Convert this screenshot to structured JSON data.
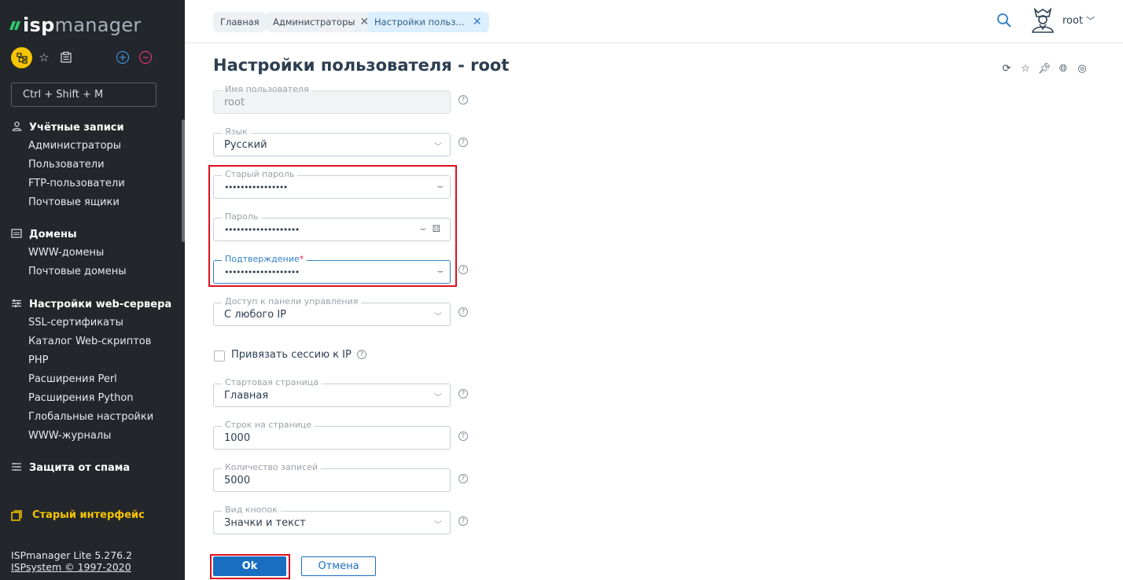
{
  "logo": {
    "prefix": "isp",
    "suffix": "manager"
  },
  "hotkey": "Ctrl + Shift + M",
  "nav": [
    {
      "title": "Учётные записи",
      "icon": "user-icon",
      "items": [
        "Администраторы",
        "Пользователи",
        "FTP-пользователи",
        "Почтовые ящики"
      ]
    },
    {
      "title": "Домены",
      "icon": "domain-icon",
      "items": [
        "WWW-домены",
        "Почтовые домены"
      ]
    },
    {
      "title": "Настройки web-сервера",
      "icon": "sliders-icon",
      "items": [
        "SSL-сертификаты",
        "Каталог Web-скриптов",
        "PHP",
        "Расширения Perl",
        "Расширения Python",
        "Глобальные настройки",
        "WWW-журналы"
      ]
    },
    {
      "title": "Защита от спама",
      "icon": "spam-icon",
      "items": []
    }
  ],
  "old_interface": "Старый интерфейс",
  "version": {
    "line1": "ISPmanager Lite 5.276.2",
    "line2": "ISPsystem © 1997-2020"
  },
  "breadcrumbs": [
    {
      "label": "Главная"
    },
    {
      "label": "Администраторы"
    },
    {
      "label": "Настройки польз…"
    }
  ],
  "user": {
    "name": "root"
  },
  "page_title": "Настройки пользователя - root",
  "form": {
    "username": {
      "label": "Имя пользователя",
      "value": "root"
    },
    "language": {
      "label": "Язык",
      "value": "Русский"
    },
    "old_password": {
      "label": "Старый пароль",
      "value": "••••••••••••••••"
    },
    "password": {
      "label": "Пароль",
      "value": "•••••••••••••••••••"
    },
    "confirm": {
      "label": "Подтверждение",
      "required": "*",
      "value": "•••••••••••••••••••"
    },
    "access": {
      "label": "Доступ к панели управления",
      "value": "С любого IP"
    },
    "bind_session": {
      "label": "Привязать сессию к IP",
      "checked": false
    },
    "start_page": {
      "label": "Стартовая страница",
      "value": "Главная"
    },
    "rows_per_page": {
      "label": "Строк на странице",
      "value": "1000"
    },
    "records_count": {
      "label": "Количество записей",
      "value": "5000"
    },
    "button_view": {
      "label": "Вид кнопок",
      "value": "Значки и текст"
    }
  },
  "buttons": {
    "ok": "Ok",
    "cancel": "Отмена"
  },
  "colors": {
    "sidebar_bg": "#23262b",
    "accent": "#1a6ec2",
    "highlight": "#e0101e",
    "active_tool": "#f5c400"
  }
}
